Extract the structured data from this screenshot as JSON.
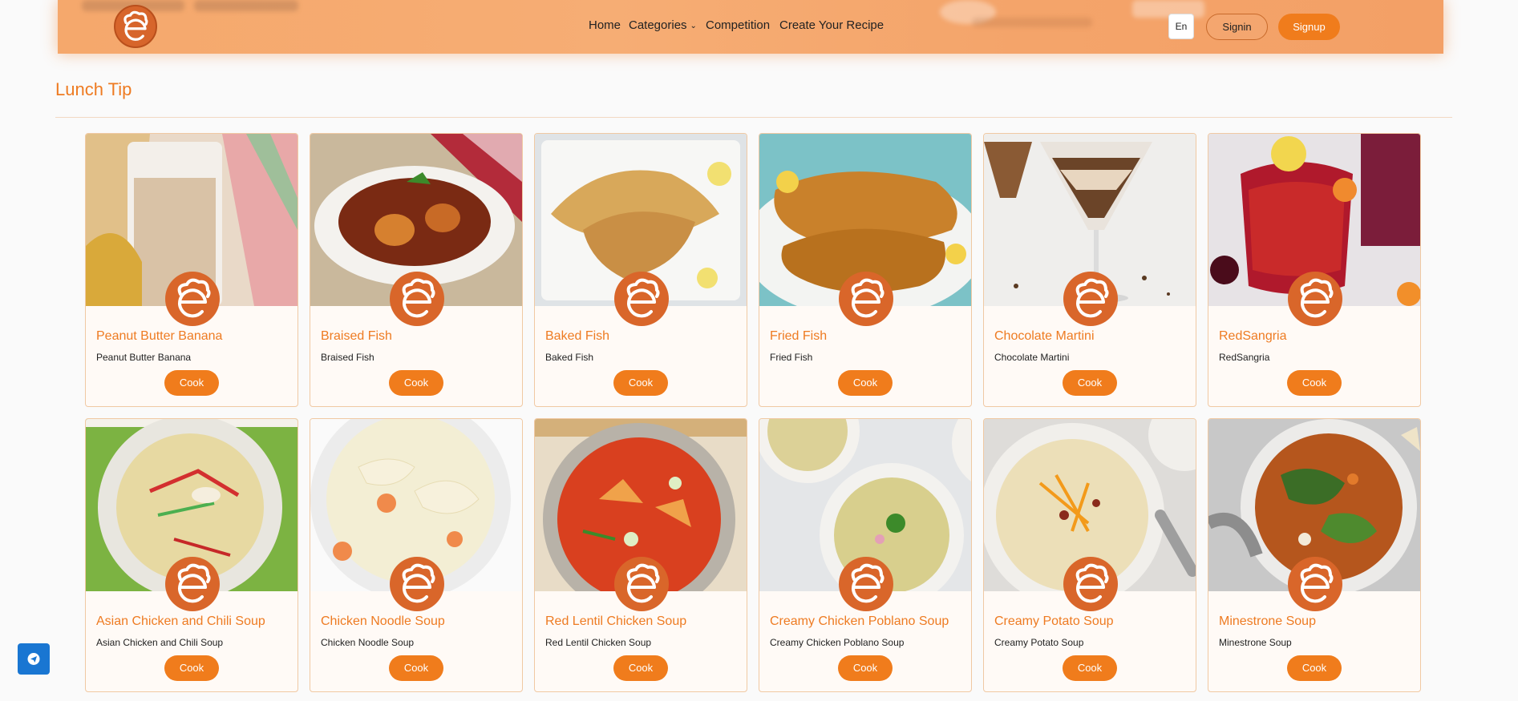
{
  "header": {
    "nav": {
      "home": "Home",
      "categories": "Categories",
      "competition": "Competition",
      "create": "Create Your Recipe"
    },
    "language": "En",
    "signin": "Signin",
    "signup": "Signup",
    "logo_icon": "chef-hat-e-logo-icon"
  },
  "section": {
    "title": "Lunch Tip"
  },
  "cook_label": "Cook",
  "recipes": [
    {
      "title": "Peanut Butter Banana",
      "subtitle": "Peanut Butter Banana"
    },
    {
      "title": "Braised Fish",
      "subtitle": "Braised Fish"
    },
    {
      "title": "Baked Fish",
      "subtitle": "Baked Fish"
    },
    {
      "title": "Fried Fish",
      "subtitle": "Fried Fish"
    },
    {
      "title": "Chocolate Martini",
      "subtitle": "Chocolate Martini"
    },
    {
      "title": "RedSangria",
      "subtitle": "RedSangria"
    },
    {
      "title": "Asian Chicken and Chili Soup",
      "subtitle": "Asian Chicken and Chili Soup"
    },
    {
      "title": "Chicken Noodle Soup",
      "subtitle": "Chicken Noodle Soup"
    },
    {
      "title": "Red Lentil Chicken Soup",
      "subtitle": "Red Lentil Chicken Soup"
    },
    {
      "title": "Creamy Chicken Poblano Soup",
      "subtitle": "Creamy Chicken Poblano Soup"
    },
    {
      "title": "Creamy Potato Soup",
      "subtitle": "Creamy Potato Soup"
    },
    {
      "title": "Minestrone Soup",
      "subtitle": "Minestrone Soup"
    }
  ],
  "colors": {
    "accent": "#f07c1c",
    "title": "#ee7b22",
    "header": "#f5a86c",
    "help": "#1976d2"
  },
  "help_icon": "telegram-icon"
}
